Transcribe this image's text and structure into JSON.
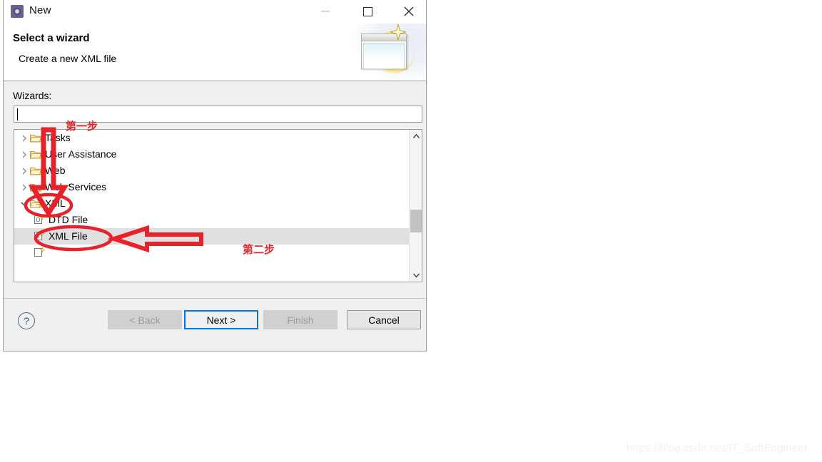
{
  "window": {
    "title": "New",
    "icon": "wizard-gear-icon",
    "controls": {
      "minimize": "—",
      "maximize": "▢",
      "close": "✕"
    }
  },
  "header": {
    "title": "Select a wizard",
    "description": "Create a new XML file",
    "banner_icon": "wizard-sparkle-window-icon"
  },
  "body": {
    "wizards_label": "Wizards:",
    "search": {
      "value": "",
      "placeholder": ""
    },
    "tree": [
      {
        "label": "Tasks",
        "type": "folder",
        "expanded": false,
        "indent": 0,
        "selected": false,
        "icon": "folder-icon"
      },
      {
        "label": "User Assistance",
        "type": "folder",
        "expanded": false,
        "indent": 0,
        "selected": false,
        "icon": "folder-icon"
      },
      {
        "label": "Web",
        "type": "folder",
        "expanded": false,
        "indent": 0,
        "selected": false,
        "icon": "folder-icon"
      },
      {
        "label": "Web Services",
        "type": "folder",
        "expanded": false,
        "indent": 0,
        "selected": false,
        "icon": "folder-icon"
      },
      {
        "label": "XML",
        "type": "folder",
        "expanded": true,
        "indent": 0,
        "selected": false,
        "icon": "folder-open-icon"
      },
      {
        "label": "DTD File",
        "type": "file",
        "indent": 1,
        "selected": false,
        "icon": "dtd-file-icon",
        "badge": "D"
      },
      {
        "label": "XML File",
        "type": "file",
        "indent": 1,
        "selected": true,
        "icon": "xml-file-icon",
        "badge": "x"
      }
    ],
    "scrollbar": {
      "up": "⌃",
      "down": "⌄"
    }
  },
  "footer": {
    "help": "?",
    "back": "< Back",
    "next": "Next >",
    "finish": "Finish",
    "cancel": "Cancel"
  },
  "annotations": {
    "step1": "第一步",
    "step2": "第二步",
    "color": "#e8222a"
  },
  "watermark": "https://blog.csdn.net/IT_SoftEngineer"
}
